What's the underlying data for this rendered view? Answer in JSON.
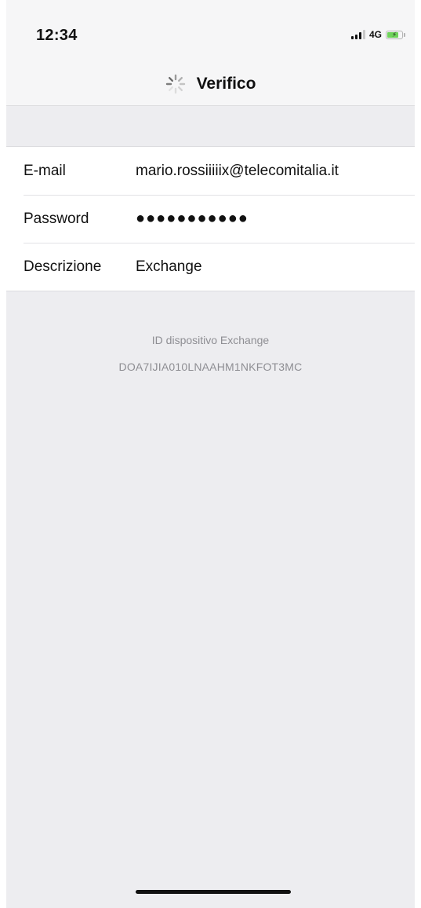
{
  "status_bar": {
    "time": "12:34",
    "network": "4G",
    "icons": [
      "signal-icon",
      "battery-charging-icon"
    ],
    "battery_color": "#6fd35b"
  },
  "nav": {
    "title": "Verifico",
    "activity_indicator": "spinner-icon"
  },
  "form": {
    "rows": [
      {
        "label": "E-mail",
        "value": "mario.rossiiiiix@telecomitalia.it"
      },
      {
        "label": "Password",
        "value": "●●●●●●●●●●●"
      },
      {
        "label": "Descrizione",
        "value": "Exchange"
      }
    ]
  },
  "device_info": {
    "label": "ID dispositivo Exchange",
    "id": "DOA7IJIA010LNAAHM1NKFOT3MC"
  },
  "colors": {
    "background": "#ededf0",
    "bar_background": "#f6f6f7",
    "secondary_text": "#8e8e93"
  }
}
